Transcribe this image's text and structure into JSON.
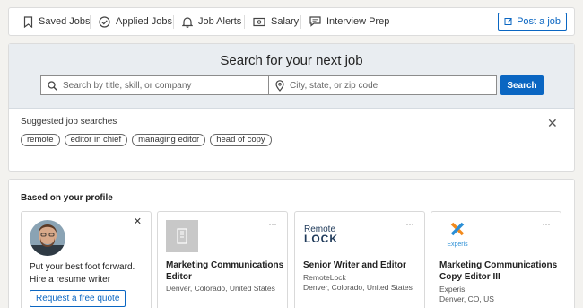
{
  "nav": {
    "items": [
      {
        "label": "Saved Jobs",
        "icon": "bookmark-icon"
      },
      {
        "label": "Applied Jobs",
        "icon": "check-circle-icon"
      },
      {
        "label": "Job Alerts",
        "icon": "bell-icon"
      },
      {
        "label": "Salary",
        "icon": "salary-icon"
      },
      {
        "label": "Interview Prep",
        "icon": "chat-icon"
      }
    ],
    "post_job": "Post a job"
  },
  "search": {
    "title": "Search for your next job",
    "keyword_placeholder": "Search by title, skill, or company",
    "location_placeholder": "City, state, or zip code",
    "button": "Search"
  },
  "suggested": {
    "title": "Suggested job searches",
    "chips": [
      "remote",
      "editor in chief",
      "managing editor",
      "head of copy"
    ]
  },
  "profile": {
    "title": "Based on your profile",
    "promo": {
      "text": "Put your best foot forward. Hire a resume writer",
      "button": "Request a free quote"
    },
    "jobs": [
      {
        "title": "Marketing Communications Editor",
        "company": "",
        "location": "Denver, Colorado, United States"
      },
      {
        "title": "Senior Writer and Editor",
        "company": "RemoteLock",
        "location": "Denver, Colorado, United States",
        "logo_text": "Remote",
        "logo_text2": "LOCK"
      },
      {
        "title": "Marketing Communications Copy Editor III",
        "company": "Experis",
        "location": "Denver, CO, US",
        "logo_text": "Experis"
      }
    ]
  },
  "colors": {
    "accent": "#0a66c2",
    "background": "#f3f2ef"
  }
}
